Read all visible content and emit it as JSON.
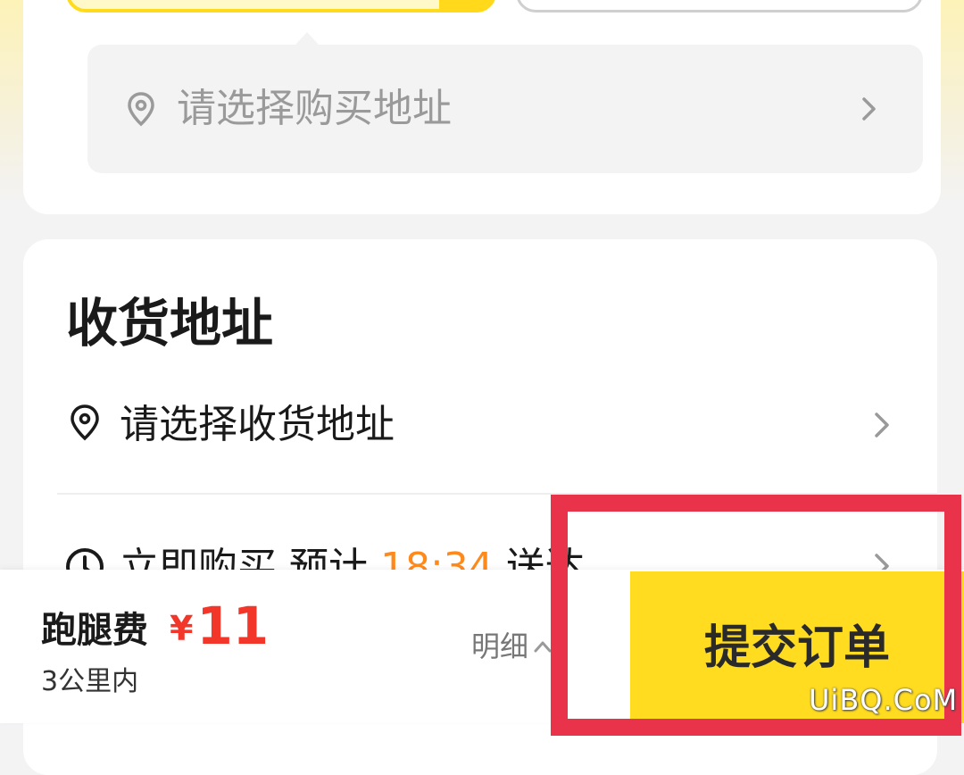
{
  "purchase": {
    "address_placeholder": "请选择购买地址"
  },
  "delivery": {
    "section_title": "收货地址",
    "address_placeholder": "请选择收货地址",
    "time_prefix": "立即购买 预计 ",
    "time_value": "18:34",
    "time_suffix": " 送达"
  },
  "footer": {
    "fee_label": "跑腿费",
    "currency": "¥",
    "fee_amount": "11",
    "distance_note": "3公里内",
    "detail_label": "明细",
    "submit_label": "提交订单"
  },
  "colors": {
    "accent_yellow": "#ffdc1f",
    "price_red": "#f2362a",
    "time_orange": "#ff8a1c",
    "highlight_red": "#e8334b"
  },
  "watermark": "UiBQ.CoM"
}
